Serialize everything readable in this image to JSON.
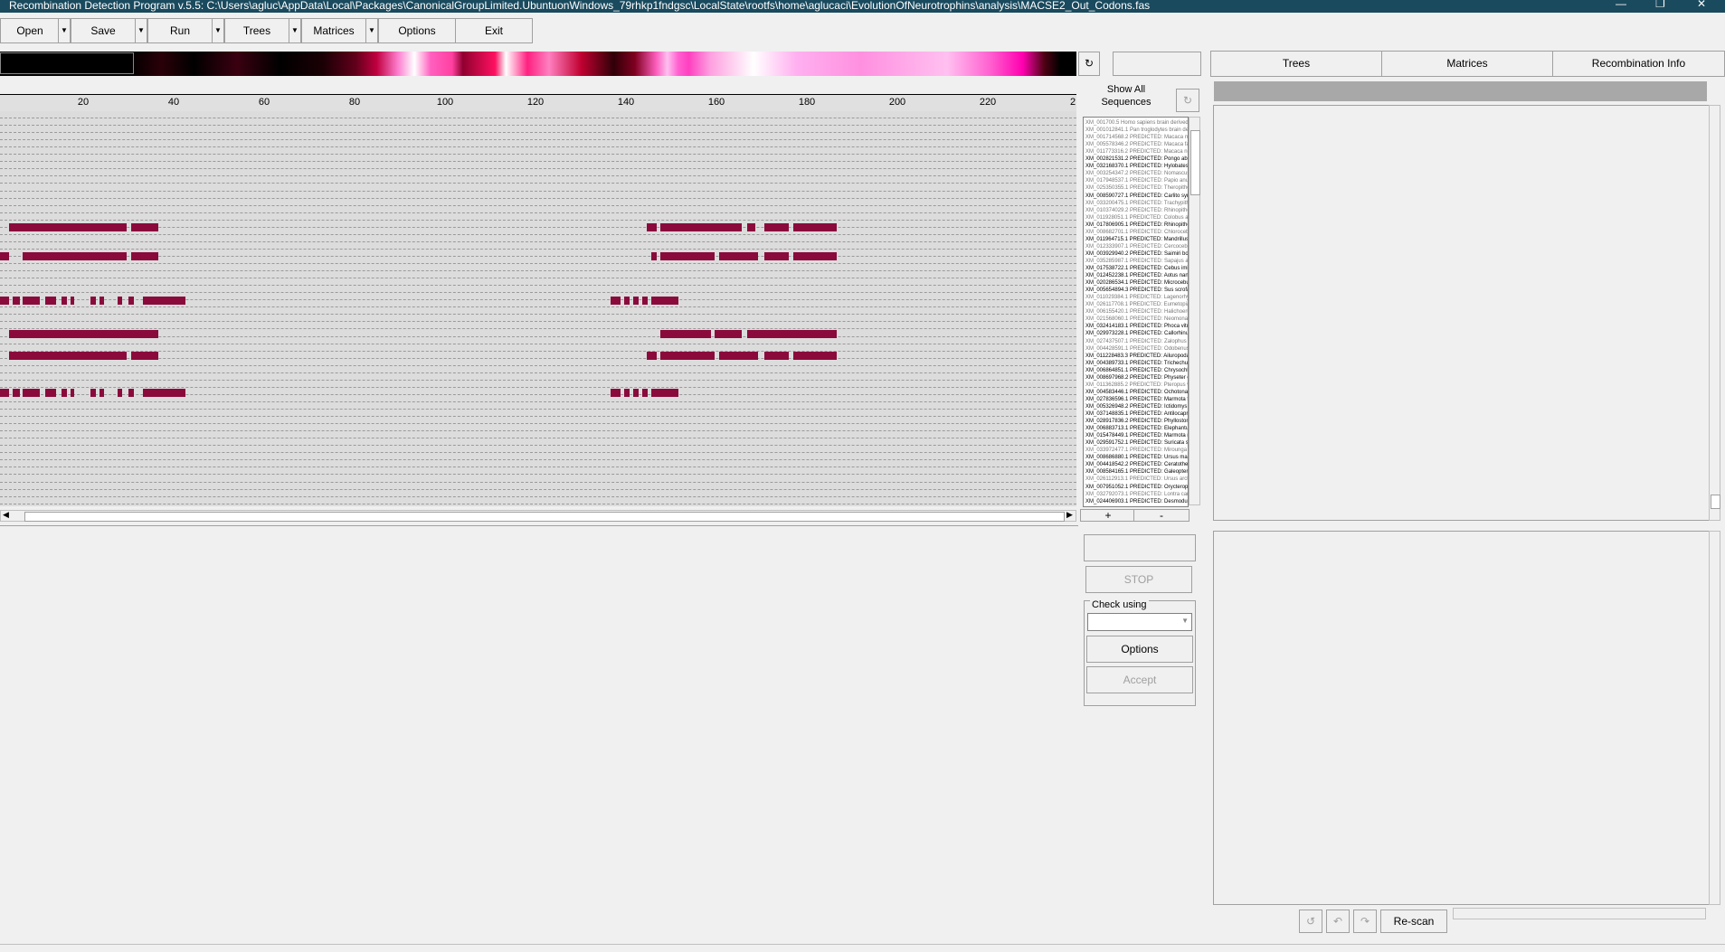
{
  "window": {
    "title": "Recombination Detection Program v.5.5:  C:\\Users\\agluc\\AppData\\Local\\Packages\\CanonicalGroupLimited.UbuntuonWindows_79rhkp1fndgsc\\LocalState\\rootfs\\home\\aglucaci\\EvolutionOfNeurotrophins\\analysis\\MACSE2_Out_Codons.fas",
    "minimize": "—",
    "maximize": "❐",
    "close": "✕"
  },
  "toolbar": {
    "open": "Open",
    "save": "Save",
    "run": "Run",
    "trees": "Trees",
    "matrices": "Matrices",
    "options": "Options",
    "exit": "Exit",
    "dropdown_glyph": "▼"
  },
  "ruler": {
    "labels": [
      "20",
      "40",
      "60",
      "80",
      "100",
      "120",
      "140",
      "160",
      "180",
      "200",
      "220",
      "2"
    ]
  },
  "sequence_panel": {
    "show_all_line1": "Show All",
    "show_all_line2": "Sequences",
    "plus": "+",
    "minus": "-",
    "sequences": [
      "XM_001700.5 Homo sapiens brain derived n",
      "XM_001012841.1 Pan troglodytes brain deriv",
      "XM_001714568.2 PREDICTED: Macaca mu",
      "XM_005578346.2 PREDICTED: Macaca fasc",
      "XM_011773316.2 PREDICTED: Macaca nem",
      "XM_002821531.2 PREDICTED: Pongo abeli",
      "XM_032168370.1 PREDICTED: Hylobates m",
      "XM_003254347.2 PREDICTED: Nomascus",
      "XM_017948537.1 PREDICTED: Papio anubi",
      "XM_025350355.1 PREDICTED: Theropithec",
      "XM_008590727.1 PREDICTED: Carlito syric",
      "XM_033200475.1 PREDICTED: Trachypithe",
      "XM_010374029.2 PREDICTED: Rhinopithec",
      "XM_011928051.1 PREDICTED: Colobus ang",
      "XM_017806905.1 PREDICTED: Rhinopithec",
      "XM_008682701.1 PREDICTED: Chlorocebu",
      "XM_011964715.1 PREDICTED: Mandrillus l",
      "XM_012333907.1 PREDICTED: Cercocebus",
      "XM_003929940.2 PREDICTED: Saimiri bolivi",
      "XM_035285987.1 PREDICTED: Sapajus ap",
      "XM_017538722.1 PREDICTED: Cebus imita",
      "XM_012452238.1 PREDICTED: Aotus nanc",
      "XM_020286534.1 PREDICTED: Microcebus",
      "XM_005654894.3 PREDICTED: Sus scrofa",
      "XM_011029384.1 PREDICTED: Lagenorhync",
      "XM_026117708.1 PREDICTED: Eumetopias",
      "XM_006155420.1 PREDICTED: Halichoerus",
      "XM_021568060.1 PREDICTED: Neomonach",
      "XM_032414183.1 PREDICTED: Phoca vitul",
      "XM_029973228.1 PREDICTED: Callorhinus",
      "XM_027437507.1 PREDICTED: Zalophus c",
      "XM_004428591.1 PREDICTED: Odobenus r",
      "XM_011228483.3 PREDICTED: Ailuropoda r",
      "XM_004389733.1 PREDICTED: Trichechus",
      "XM_006864851.1 PREDICTED: Chrysochlori",
      "XM_008697968.2 PREDICTED: Physeter ca",
      "XM_011362885.2 PREDICTED: Pteropus v",
      "XM_004583446.1 PREDICTED: Ochotona p",
      "XM_027836596.1 PREDICTED: Marmota fl",
      "XM_005326948.2 PREDICTED: Ictidomys t",
      "XM_037148835.1 PREDICTED: Antilocapra",
      "XM_028917836.2 PREDICTED: Phyllostom",
      "XM_006883713.1 PREDICTED: Elephantulu",
      "XM_015478449.1 PREDICTED: Marmota m",
      "XM_029591752.1 PREDICTED: Suricata su",
      "XM_033972477.1 PREDICTED: Mirounga le",
      "XM_008686880.1 PREDICTED: Ursus marit",
      "XM_004418542.2 PREDICTED: Ceratother",
      "XM_008584165.1 PREDICTED: Galeopterus",
      "XM_026112913.1 PREDICTED: Ursus arcto",
      "XM_007951052.1 PREDICTED: Orycteropus",
      "XM_032792073.1 PREDICTED: Lontra cana",
      "XM_024406903.1 PREDICTED: Desmodus"
    ]
  },
  "tabs": {
    "trees": "Trees",
    "matrices": "Matrices",
    "recombination_info": "Recombination Info"
  },
  "check_panel": {
    "stop": "STOP",
    "check_using": "Check using",
    "select_value": "",
    "options": "Options",
    "accept": "Accept"
  },
  "bottom_right": {
    "rescan": "Re-scan"
  }
}
